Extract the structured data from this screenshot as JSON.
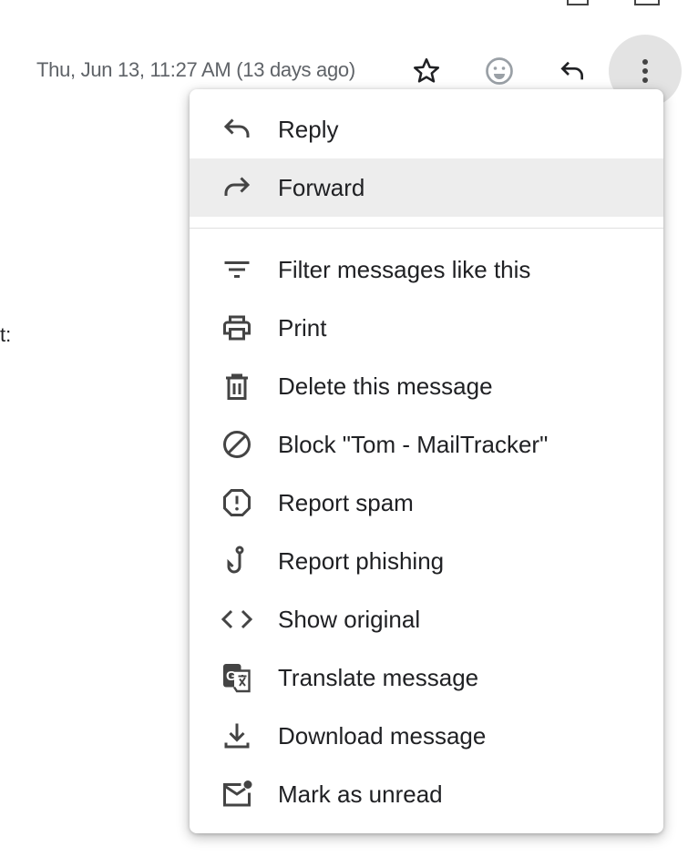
{
  "header": {
    "date": "Thu, Jun 13, 11:27 AM (13 days ago)",
    "icons": [
      "star-icon",
      "emoji-icon",
      "reply-icon",
      "more-vert-icon"
    ]
  },
  "body_fragment": "t:",
  "menu": {
    "items": [
      {
        "label": "Reply",
        "icon": "reply-icon"
      },
      {
        "label": "Forward",
        "icon": "forward-icon",
        "highlighted": true
      },
      {
        "label": "Filter messages like this",
        "icon": "filter-icon"
      },
      {
        "label": "Print",
        "icon": "print-icon"
      },
      {
        "label": "Delete this message",
        "icon": "trash-icon"
      },
      {
        "label": "Block \"Tom - MailTracker\"",
        "icon": "block-icon"
      },
      {
        "label": "Report spam",
        "icon": "spam-icon"
      },
      {
        "label": "Report phishing",
        "icon": "phishing-hook-icon"
      },
      {
        "label": "Show original",
        "icon": "code-icon"
      },
      {
        "label": "Translate message",
        "icon": "translate-icon"
      },
      {
        "label": "Download message",
        "icon": "download-icon"
      },
      {
        "label": "Mark as unread",
        "icon": "mark-unread-icon"
      }
    ]
  }
}
